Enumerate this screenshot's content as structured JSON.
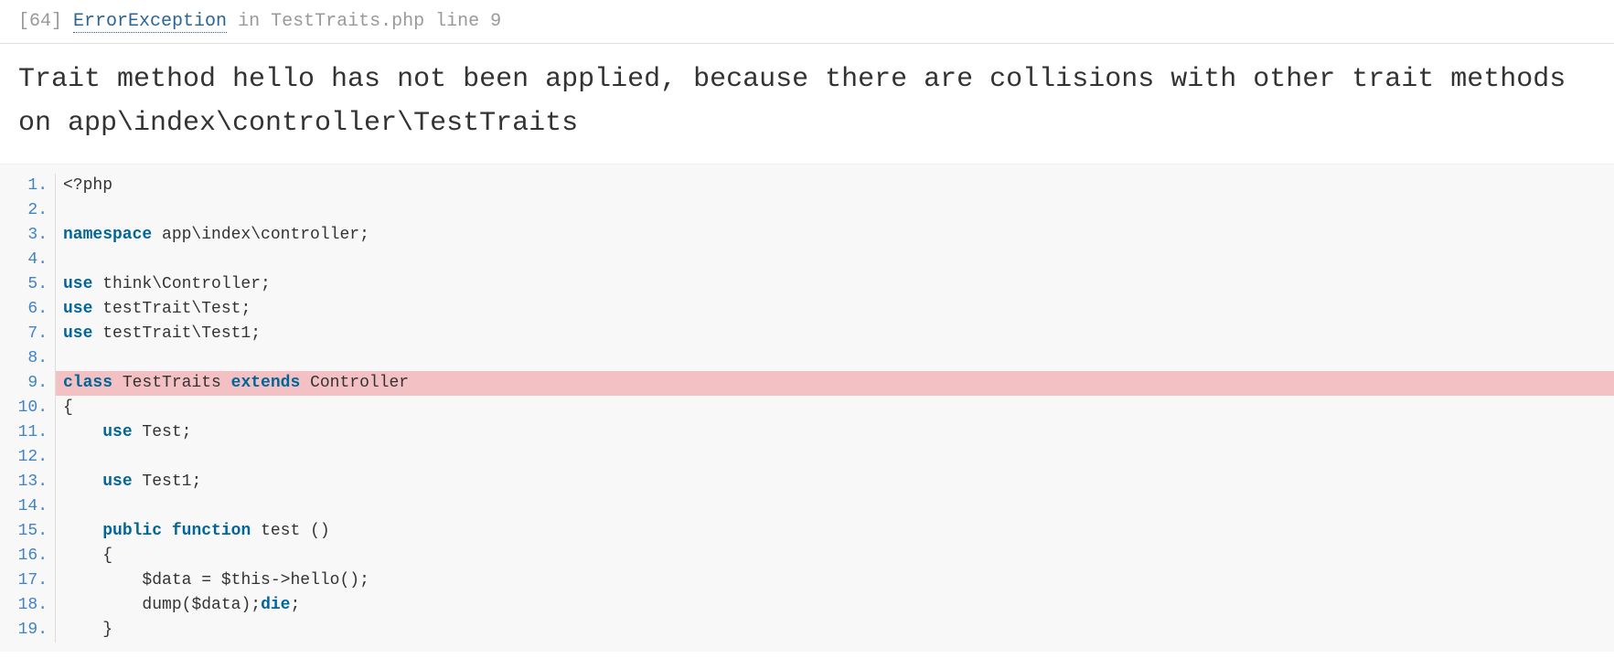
{
  "header": {
    "error_code": "[64]",
    "exception_name": "ErrorException",
    "in_text": " in ",
    "file_line": "TestTraits.php line 9"
  },
  "error_message": "Trait method hello has not been applied, because there are collisions with other trait methods on app\\index\\controller\\TestTraits",
  "code": {
    "lines": [
      {
        "n": "1.",
        "tokens": [
          [
            "#333",
            "<?php"
          ]
        ]
      },
      {
        "n": "2.",
        "tokens": []
      },
      {
        "n": "3.",
        "tokens": [
          [
            "#069",
            "namespace"
          ],
          [
            "#333",
            " app\\index\\controller"
          ],
          [
            "#333",
            ";"
          ]
        ]
      },
      {
        "n": "4.",
        "tokens": []
      },
      {
        "n": "5.",
        "tokens": [
          [
            "#069",
            "use"
          ],
          [
            "#333",
            " think\\Controller"
          ],
          [
            "#333",
            ";"
          ]
        ]
      },
      {
        "n": "6.",
        "tokens": [
          [
            "#069",
            "use"
          ],
          [
            "#333",
            " testTrait\\Test"
          ],
          [
            "#333",
            ";"
          ]
        ]
      },
      {
        "n": "7.",
        "tokens": [
          [
            "#069",
            "use"
          ],
          [
            "#333",
            " testTrait\\Test1"
          ],
          [
            "#333",
            ";"
          ]
        ]
      },
      {
        "n": "8.",
        "tokens": []
      },
      {
        "n": "9.",
        "tokens": [
          [
            "#069",
            "class"
          ],
          [
            "#333",
            " TestTraits "
          ],
          [
            "#069",
            "extends"
          ],
          [
            "#333",
            " Controller"
          ]
        ],
        "highlighted": true
      },
      {
        "n": "10.",
        "tokens": [
          [
            "#333",
            "{"
          ]
        ]
      },
      {
        "n": "11.",
        "tokens": [
          [
            "#333",
            "    "
          ],
          [
            "#069",
            "use"
          ],
          [
            "#333",
            " Test"
          ],
          [
            "#333",
            ";"
          ]
        ]
      },
      {
        "n": "12.",
        "tokens": []
      },
      {
        "n": "13.",
        "tokens": [
          [
            "#333",
            "    "
          ],
          [
            "#069",
            "use"
          ],
          [
            "#333",
            " Test1"
          ],
          [
            "#333",
            ";"
          ]
        ]
      },
      {
        "n": "14.",
        "tokens": []
      },
      {
        "n": "15.",
        "tokens": [
          [
            "#333",
            "    "
          ],
          [
            "#069",
            "public"
          ],
          [
            "#333",
            " "
          ],
          [
            "#069",
            "function"
          ],
          [
            "#333",
            " test "
          ],
          [
            "#333",
            "()"
          ]
        ]
      },
      {
        "n": "16.",
        "tokens": [
          [
            "#333",
            "    {"
          ]
        ]
      },
      {
        "n": "17.",
        "tokens": [
          [
            "#333",
            "        $data "
          ],
          [
            "#333",
            "="
          ],
          [
            "#333",
            " $this"
          ],
          [
            "#333",
            "->"
          ],
          [
            "#333",
            "hello"
          ],
          [
            "#333",
            "();"
          ]
        ]
      },
      {
        "n": "18.",
        "tokens": [
          [
            "#333",
            "        dump"
          ],
          [
            "#333",
            "("
          ],
          [
            "#333",
            "$data"
          ],
          [
            "#333",
            ")"
          ],
          [
            "#333",
            ";"
          ],
          [
            "#069",
            "die"
          ],
          [
            "#333",
            ";"
          ]
        ]
      },
      {
        "n": "19.",
        "tokens": [
          [
            "#333",
            "    }"
          ]
        ]
      }
    ]
  }
}
